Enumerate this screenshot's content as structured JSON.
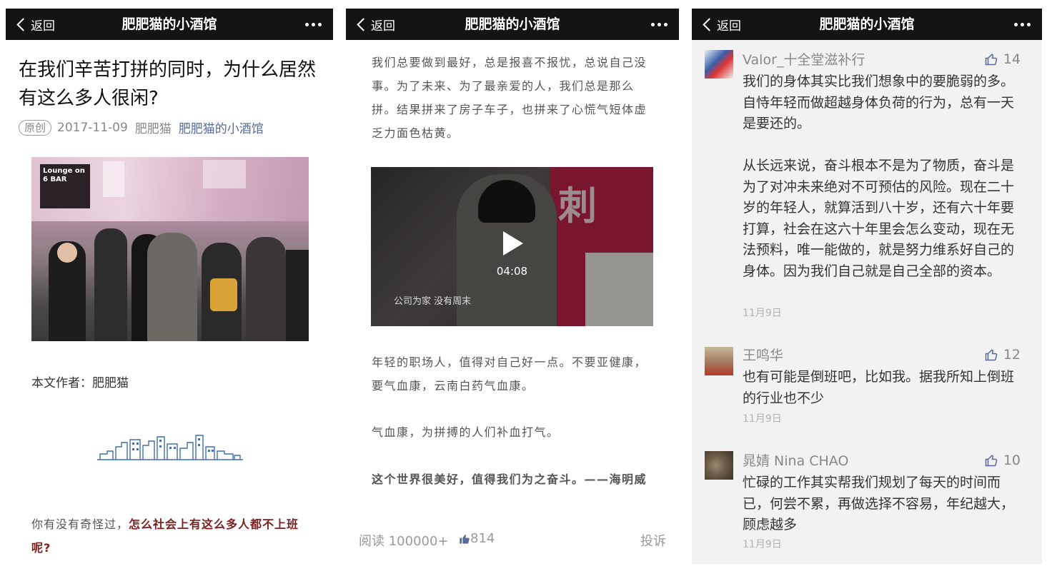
{
  "nav": {
    "back_label": "返回",
    "title": "肥肥猫的小酒馆"
  },
  "p1": {
    "title": "在我们辛苦打拼的同时，为什么居然有这么多人很闲?",
    "badge": "原创",
    "date": "2017-11-09",
    "author": "肥肥猫",
    "account": "肥肥猫的小酒馆",
    "image_sign": "Lounge on 6 BAR",
    "author_line": "本文作者：肥肥猫",
    "para_normal": "你有没有奇怪过，",
    "para_highlight": "怎么社会上有这么多人都不上班呢?"
  },
  "p2": {
    "para1": "我们总要做到最好，总是报喜不报忧，总说自己没事。为了未来、为了最亲爱的人，我们总是那么拼。结果拼来了房子车子，也拼来了心慌气短体虚乏力面色枯黄。",
    "video": {
      "duration": "04:08",
      "caption": "公司为家  没有周末",
      "sign_char": "刺"
    },
    "para2": "年轻的职场人，值得对自己好一点。不要亚健康，要气血康，云南白药气血康。",
    "para3": "气血康，为拼搏的人们补血打气。",
    "quote": "这个世界很美好，值得我们为之奋斗。——海明威",
    "footer": {
      "read": "阅读 100000+",
      "likes": "814",
      "report": "投诉"
    }
  },
  "comments": [
    {
      "name": "Valor_十全堂滋补行",
      "likes": "14",
      "text": "我们的身体其实比我们想象中的要脆弱的多。自恃年轻而做超越身体负荷的行为，总有一天是要还的。\n\n从长远来说，奋斗根本不是为了物质，奋斗是为了对冲未来绝对不可预估的风险。现在二十岁的年轻人，就算活到八十岁，还有六十年要打算，社会在这六十年里会怎么变动，现在无法预料，唯一能做的，就是努力维系好自己的身体。因为我们自己就是自己全部的资本。",
      "date": "11月9日"
    },
    {
      "name": "王鸣华",
      "likes": "12",
      "text": "也有可能是倒班吧，比如我。据我所知上倒班的行业也不少",
      "date": "11月9日"
    },
    {
      "name": "晁婧 Nina CHAO",
      "likes": "10",
      "text": "忙碌的工作其实帮我们规划了每天的时间而已，何尝不累，再做选择不容易，年纪越大，顾虑越多",
      "date": "11月9日"
    }
  ],
  "colors": {
    "navbar": "#141414",
    "link": "#576b95",
    "highlight": "#7b1f1f",
    "comment_bg": "#f2f2f2"
  },
  "icons": [
    "back-chevron-icon",
    "more-icon",
    "play-icon",
    "thumbs-up-icon"
  ]
}
